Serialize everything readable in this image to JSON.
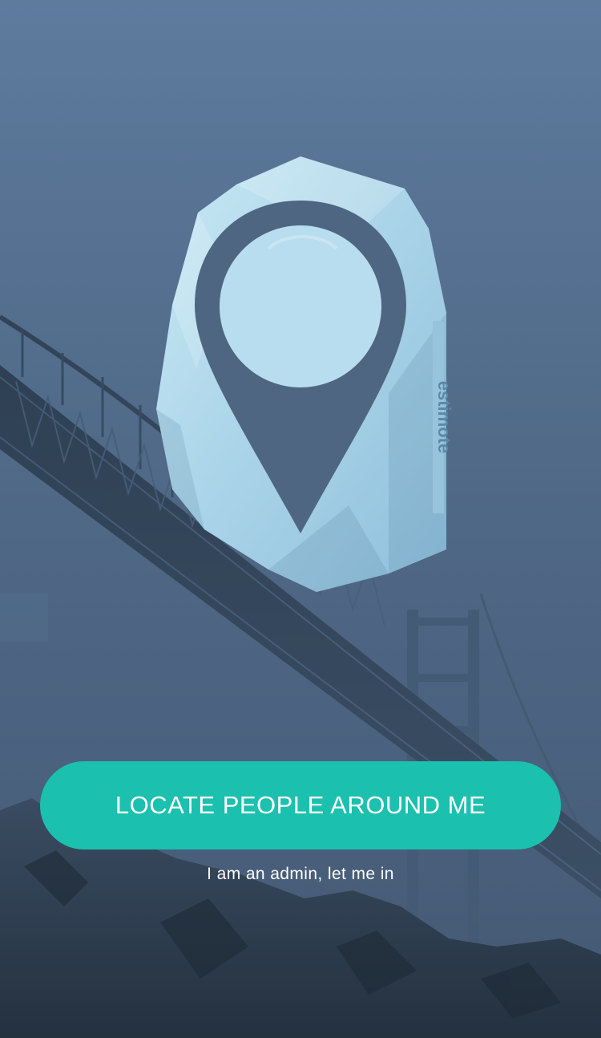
{
  "hero": {
    "logo_text": "estimote",
    "icon": "map-pin-icon"
  },
  "actions": {
    "primary_label": "LOCATE PEOPLE AROUND ME",
    "admin_label": "I am an admin, let me in"
  },
  "colors": {
    "accent": "#1bc0ae",
    "sky": "#5a7596",
    "beacon": "#b9dcec",
    "pin": "#4e6681"
  }
}
